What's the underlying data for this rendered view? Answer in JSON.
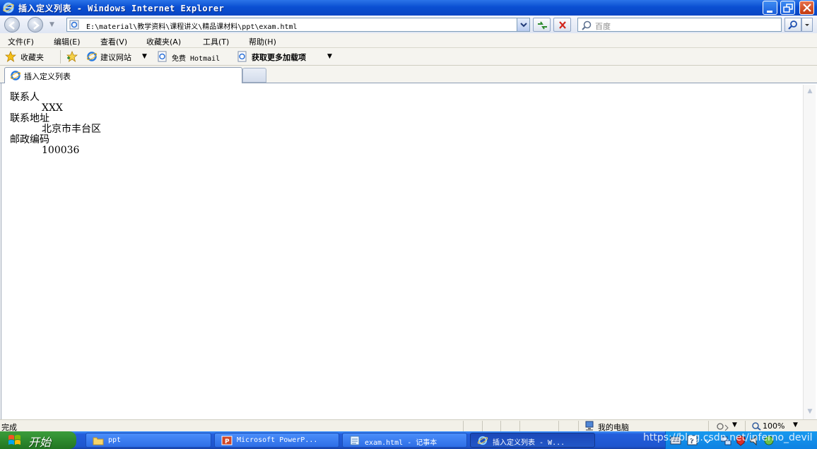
{
  "window": {
    "title": "插入定义列表 - Windows Internet Explorer"
  },
  "address_bar": {
    "url": "E:\\material\\教学资料\\课程讲义\\精品课材料\\ppt\\exam.html",
    "search_placeholder": "百度"
  },
  "menu": [
    {
      "label": "文件(F)"
    },
    {
      "label": "编辑(E)"
    },
    {
      "label": "查看(V)"
    },
    {
      "label": "收藏夹(A)"
    },
    {
      "label": "工具(T)"
    },
    {
      "label": "帮助(H)"
    }
  ],
  "favorites_bar": {
    "favorites_label": "收藏夹",
    "suggested_sites": "建议网站",
    "hotmail": "免费 Hotmail",
    "more_addons": "获取更多加载项"
  },
  "tabs": [
    {
      "label": "插入定义列表"
    }
  ],
  "content": {
    "definition_list": [
      {
        "term": "联系人",
        "description": "XXX"
      },
      {
        "term": "联系地址",
        "description": "北京市丰台区"
      },
      {
        "term": "邮政编码",
        "description": "100036"
      }
    ]
  },
  "status_bar": {
    "status": "完成",
    "zone": "我的电脑",
    "zoom": "100%"
  },
  "taskbar": {
    "start": "开始",
    "items": [
      {
        "label": "ppt",
        "icon": "folder-icon"
      },
      {
        "label": "Microsoft PowerP...",
        "icon": "powerpoint-icon"
      },
      {
        "label": "exam.html - 记事本",
        "icon": "notepad-icon"
      },
      {
        "label": "插入定义列表 - W...",
        "icon": "ie-icon"
      }
    ]
  },
  "watermark": "https://blog.csdn.net/inferno_devil"
}
